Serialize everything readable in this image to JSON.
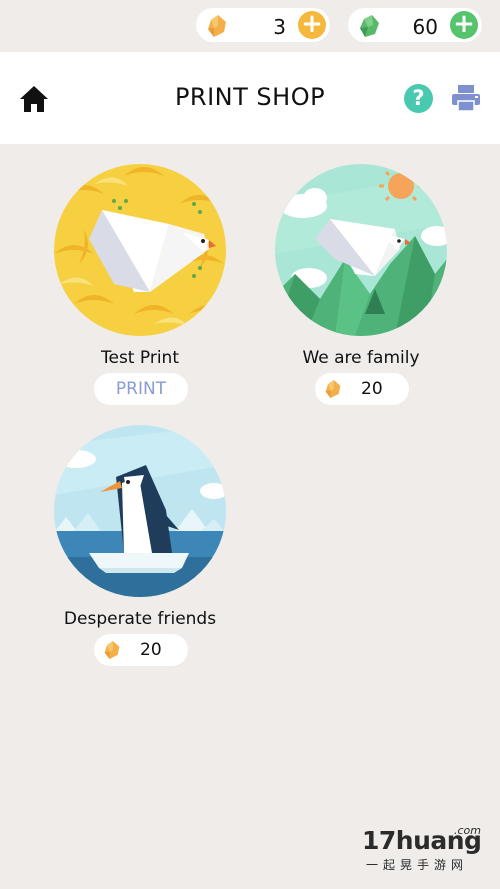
{
  "currency": {
    "leaves": {
      "value": "3",
      "plus": "+"
    },
    "gems": {
      "value": "60",
      "plus": "+"
    }
  },
  "header": {
    "title": "PRINT SHOP",
    "help_symbol": "?"
  },
  "prints": [
    {
      "title": "Test Print",
      "action_label": "PRINT",
      "artwork": "origami-bird-on-banana-pattern"
    },
    {
      "title": "We are family",
      "price": "20",
      "artwork": "origami-bird-over-forest"
    },
    {
      "title": "Desperate friends",
      "price": "20",
      "artwork": "penguin-on-ice-floe"
    }
  ],
  "watermark": {
    "brand": "17huang",
    "tld": ".com",
    "tagline": "一起晃手游网"
  },
  "colors": {
    "background": "#efece9",
    "leaf_currency": "#f6b83c",
    "gem_currency": "#55c46c",
    "help_icon": "#49c9b0",
    "print_label": "#8a9bd6"
  }
}
